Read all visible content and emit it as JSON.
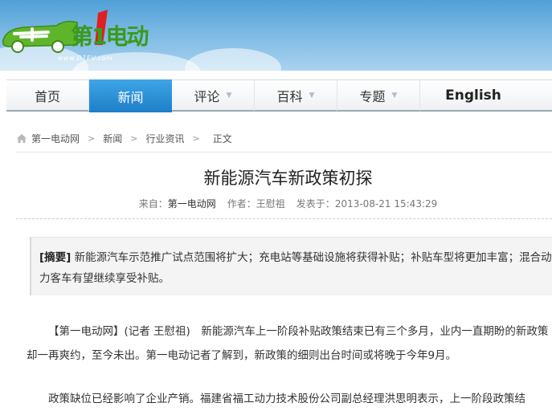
{
  "logo": {
    "text": "第1电动",
    "url": "www.D1EV.com"
  },
  "nav": {
    "items": [
      {
        "label": "首页",
        "dropdown": false,
        "active": false
      },
      {
        "label": "新闻",
        "dropdown": false,
        "active": true
      },
      {
        "label": "评论",
        "dropdown": true,
        "active": false
      },
      {
        "label": "百科",
        "dropdown": true,
        "active": false
      },
      {
        "label": "专题",
        "dropdown": true,
        "active": false
      },
      {
        "label": "English",
        "dropdown": false,
        "active": false
      }
    ],
    "active_color": "#1d7fc8"
  },
  "breadcrumb": {
    "items": [
      "第一电动网",
      "新闻",
      "行业资讯",
      "正文"
    ],
    "separator": ">"
  },
  "article": {
    "title": "新能源汽车新政策初探",
    "meta": {
      "source_label": "来自：",
      "source": "第一电动网",
      "author_label": "作者：",
      "author": "王慰祖",
      "time_label": "发表于：",
      "time": "2013-08-21 15:43:29"
    },
    "summary_label": "[摘要]",
    "summary": "新能源汽车示范推广试点范围将扩大；充电站等基础设施将获得补贴；补贴车型将更加丰富；混合动力客车有望继续享受补贴。",
    "paragraphs": [
      "【第一电动网】(记者 王慰祖)　新能源汽车上一阶段补贴政策结束已有三个多月，业内一直期盼的新政策却一再爽约，至今未出。第一电动记者了解到，新政策的细则出台时间或将晚于今年9月。",
      "政策缺位已经影响了企业产销。福建省福工动力技术股份公司副总经理洪思明表示，上一阶段政策结"
    ]
  }
}
